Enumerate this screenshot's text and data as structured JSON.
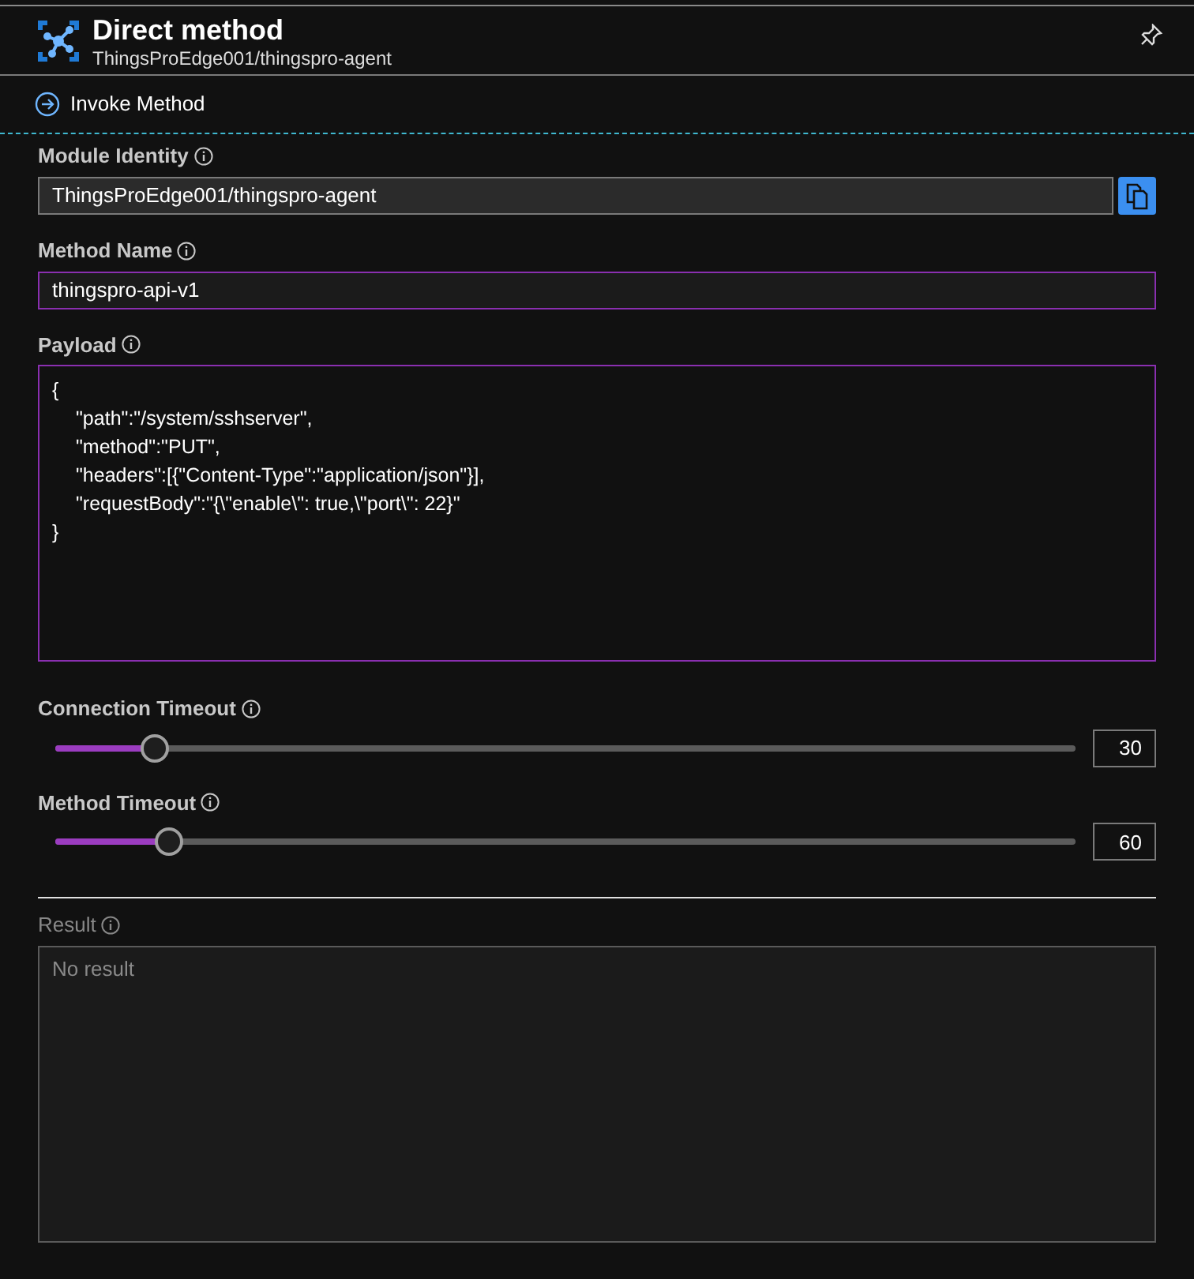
{
  "header": {
    "title": "Direct method",
    "subtitle": "ThingsProEdge001/thingspro-agent"
  },
  "toolbar": {
    "label": "Invoke Method"
  },
  "module_identity": {
    "label": "Module Identity",
    "value": "ThingsProEdge001/thingspro-agent"
  },
  "method_name": {
    "label": "Method Name",
    "value": "thingspro-api-v1"
  },
  "payload": {
    "label": "Payload",
    "lines": [
      {
        "text": "{",
        "indented": false
      },
      {
        "text": "\"path\":\"/system/sshserver\",",
        "indented": true
      },
      {
        "text": "\"method\":\"PUT\",",
        "indented": true
      },
      {
        "text": "\"headers\":[{\"Content-Type\":\"application/json\"}],",
        "indented": true
      },
      {
        "text": "\"requestBody\":\"{\\\"enable\\\": true,\\\"port\\\": 22}\"",
        "indented": true
      },
      {
        "text": "}",
        "indented": false
      }
    ]
  },
  "timeouts": [
    {
      "label": "Connection Timeout",
      "level": 0.098,
      "value": "30"
    },
    {
      "label": "Method Timeout",
      "level": 0.112,
      "value": "60"
    }
  ],
  "result": {
    "label": "Result",
    "placeholder": "No result",
    "disabled": true
  }
}
